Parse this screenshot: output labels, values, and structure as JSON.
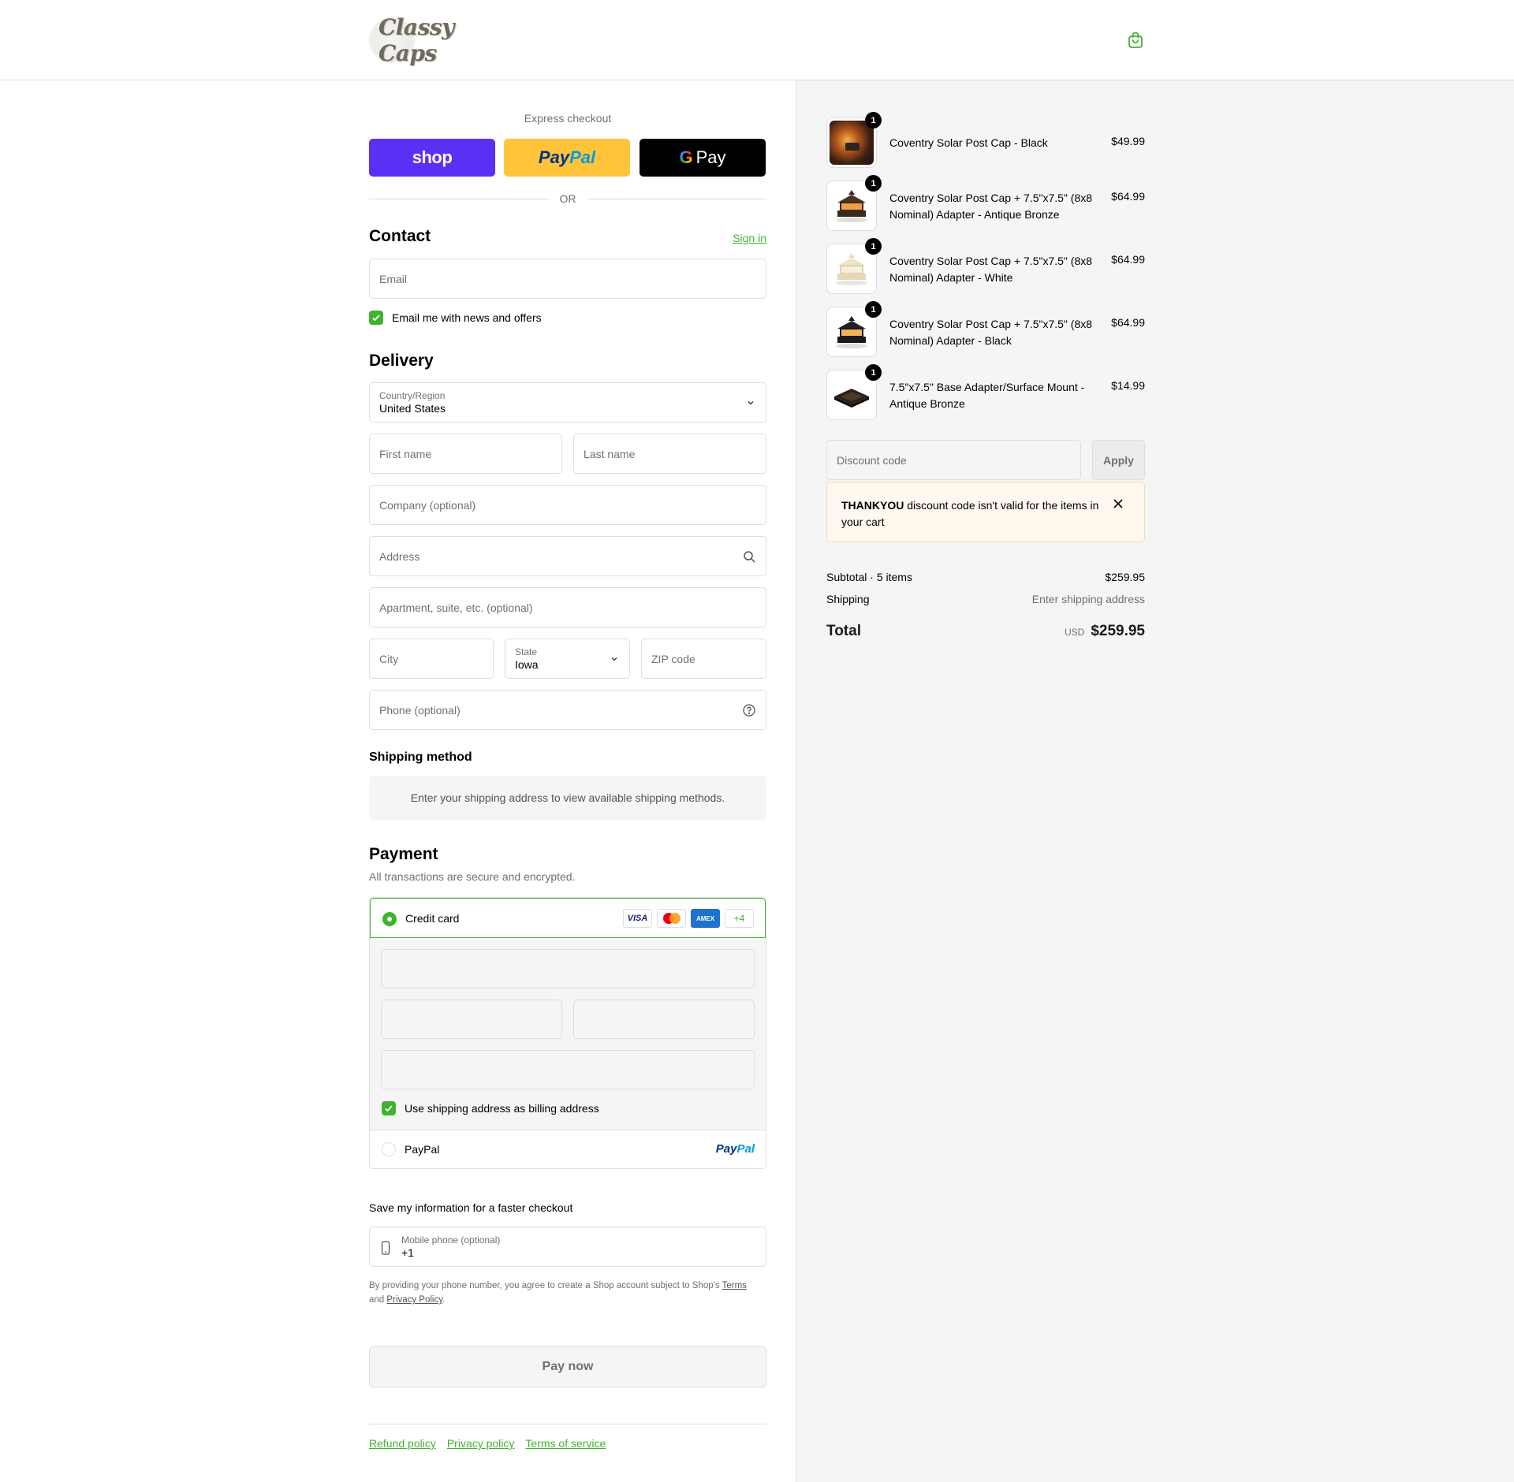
{
  "brand": {
    "logo_text": "Classy Caps"
  },
  "express": {
    "label": "Express checkout",
    "shop": "shop",
    "paypal_a": "Pay",
    "paypal_b": "Pal",
    "gpay_g": "G",
    "gpay": "Pay",
    "or": "OR"
  },
  "contact": {
    "title": "Contact",
    "sign_in": "Sign in",
    "email_placeholder": "Email",
    "news_label": "Email me with news and offers",
    "news_checked": true
  },
  "delivery": {
    "title": "Delivery",
    "country_label": "Country/Region",
    "country_value": "United States",
    "first_name": "First name",
    "last_name": "Last name",
    "company": "Company (optional)",
    "address": "Address",
    "apartment": "Apartment, suite, etc. (optional)",
    "city": "City",
    "state_label": "State",
    "state_value": "Iowa",
    "zip": "ZIP code",
    "phone": "Phone (optional)"
  },
  "shipping_method": {
    "title": "Shipping method",
    "message": "Enter your shipping address to view available shipping methods."
  },
  "payment": {
    "title": "Payment",
    "subtitle": "All transactions are secure and encrypted.",
    "credit_card": "Credit card",
    "badges": {
      "visa": "VISA",
      "amex": "AMEX",
      "more": "+4"
    },
    "billing_label": "Use shipping address as billing address",
    "paypal": "PayPal",
    "paypal_logo_a": "Pay",
    "paypal_logo_b": "Pal"
  },
  "save_info": {
    "title": "Save my information for a faster checkout",
    "phone_label": "Mobile phone (optional)",
    "phone_value": "+1",
    "note_prefix": "By providing your phone number, you agree to create a Shop account subject to Shop's",
    "terms": "Terms",
    "and": "and",
    "privacy": "Privacy Policy",
    "period": "."
  },
  "pay_now": "Pay now",
  "footer": {
    "refund": "Refund policy",
    "privacy": "Privacy policy",
    "terms": "Terms of service"
  },
  "cart": {
    "items": [
      {
        "name": "Coventry Solar Post Cap - Black",
        "price": "$49.99",
        "qty": "1"
      },
      {
        "name": "Coventry Solar Post Cap + 7.5\"x7.5\" (8x8 Nominal) Adapter - Antique Bronze",
        "price": "$64.99",
        "qty": "1"
      },
      {
        "name": "Coventry Solar Post Cap + 7.5\"x7.5\" (8x8 Nominal) Adapter - White",
        "price": "$64.99",
        "qty": "1"
      },
      {
        "name": "Coventry Solar Post Cap + 7.5\"x7.5\" (8x8 Nominal) Adapter - Black",
        "price": "$64.99",
        "qty": "1"
      },
      {
        "name": "7.5\"x7.5\" Base Adapter/Surface Mount - Antique Bronze",
        "price": "$14.99",
        "qty": "1"
      }
    ],
    "discount_placeholder": "Discount code",
    "apply": "Apply",
    "warning_code": "THANKYOU",
    "warning_text": " discount code isn't valid for the items in your cart",
    "subtotal_label": "Subtotal · 5 items",
    "subtotal_value": "$259.95",
    "shipping_label": "Shipping",
    "shipping_value": "Enter shipping address",
    "total_label": "Total",
    "currency": "USD",
    "total_value": "$259.95"
  },
  "colors": {
    "accent": "#40b230",
    "shop": "#5a31f4",
    "paypal": "#ffc439"
  }
}
